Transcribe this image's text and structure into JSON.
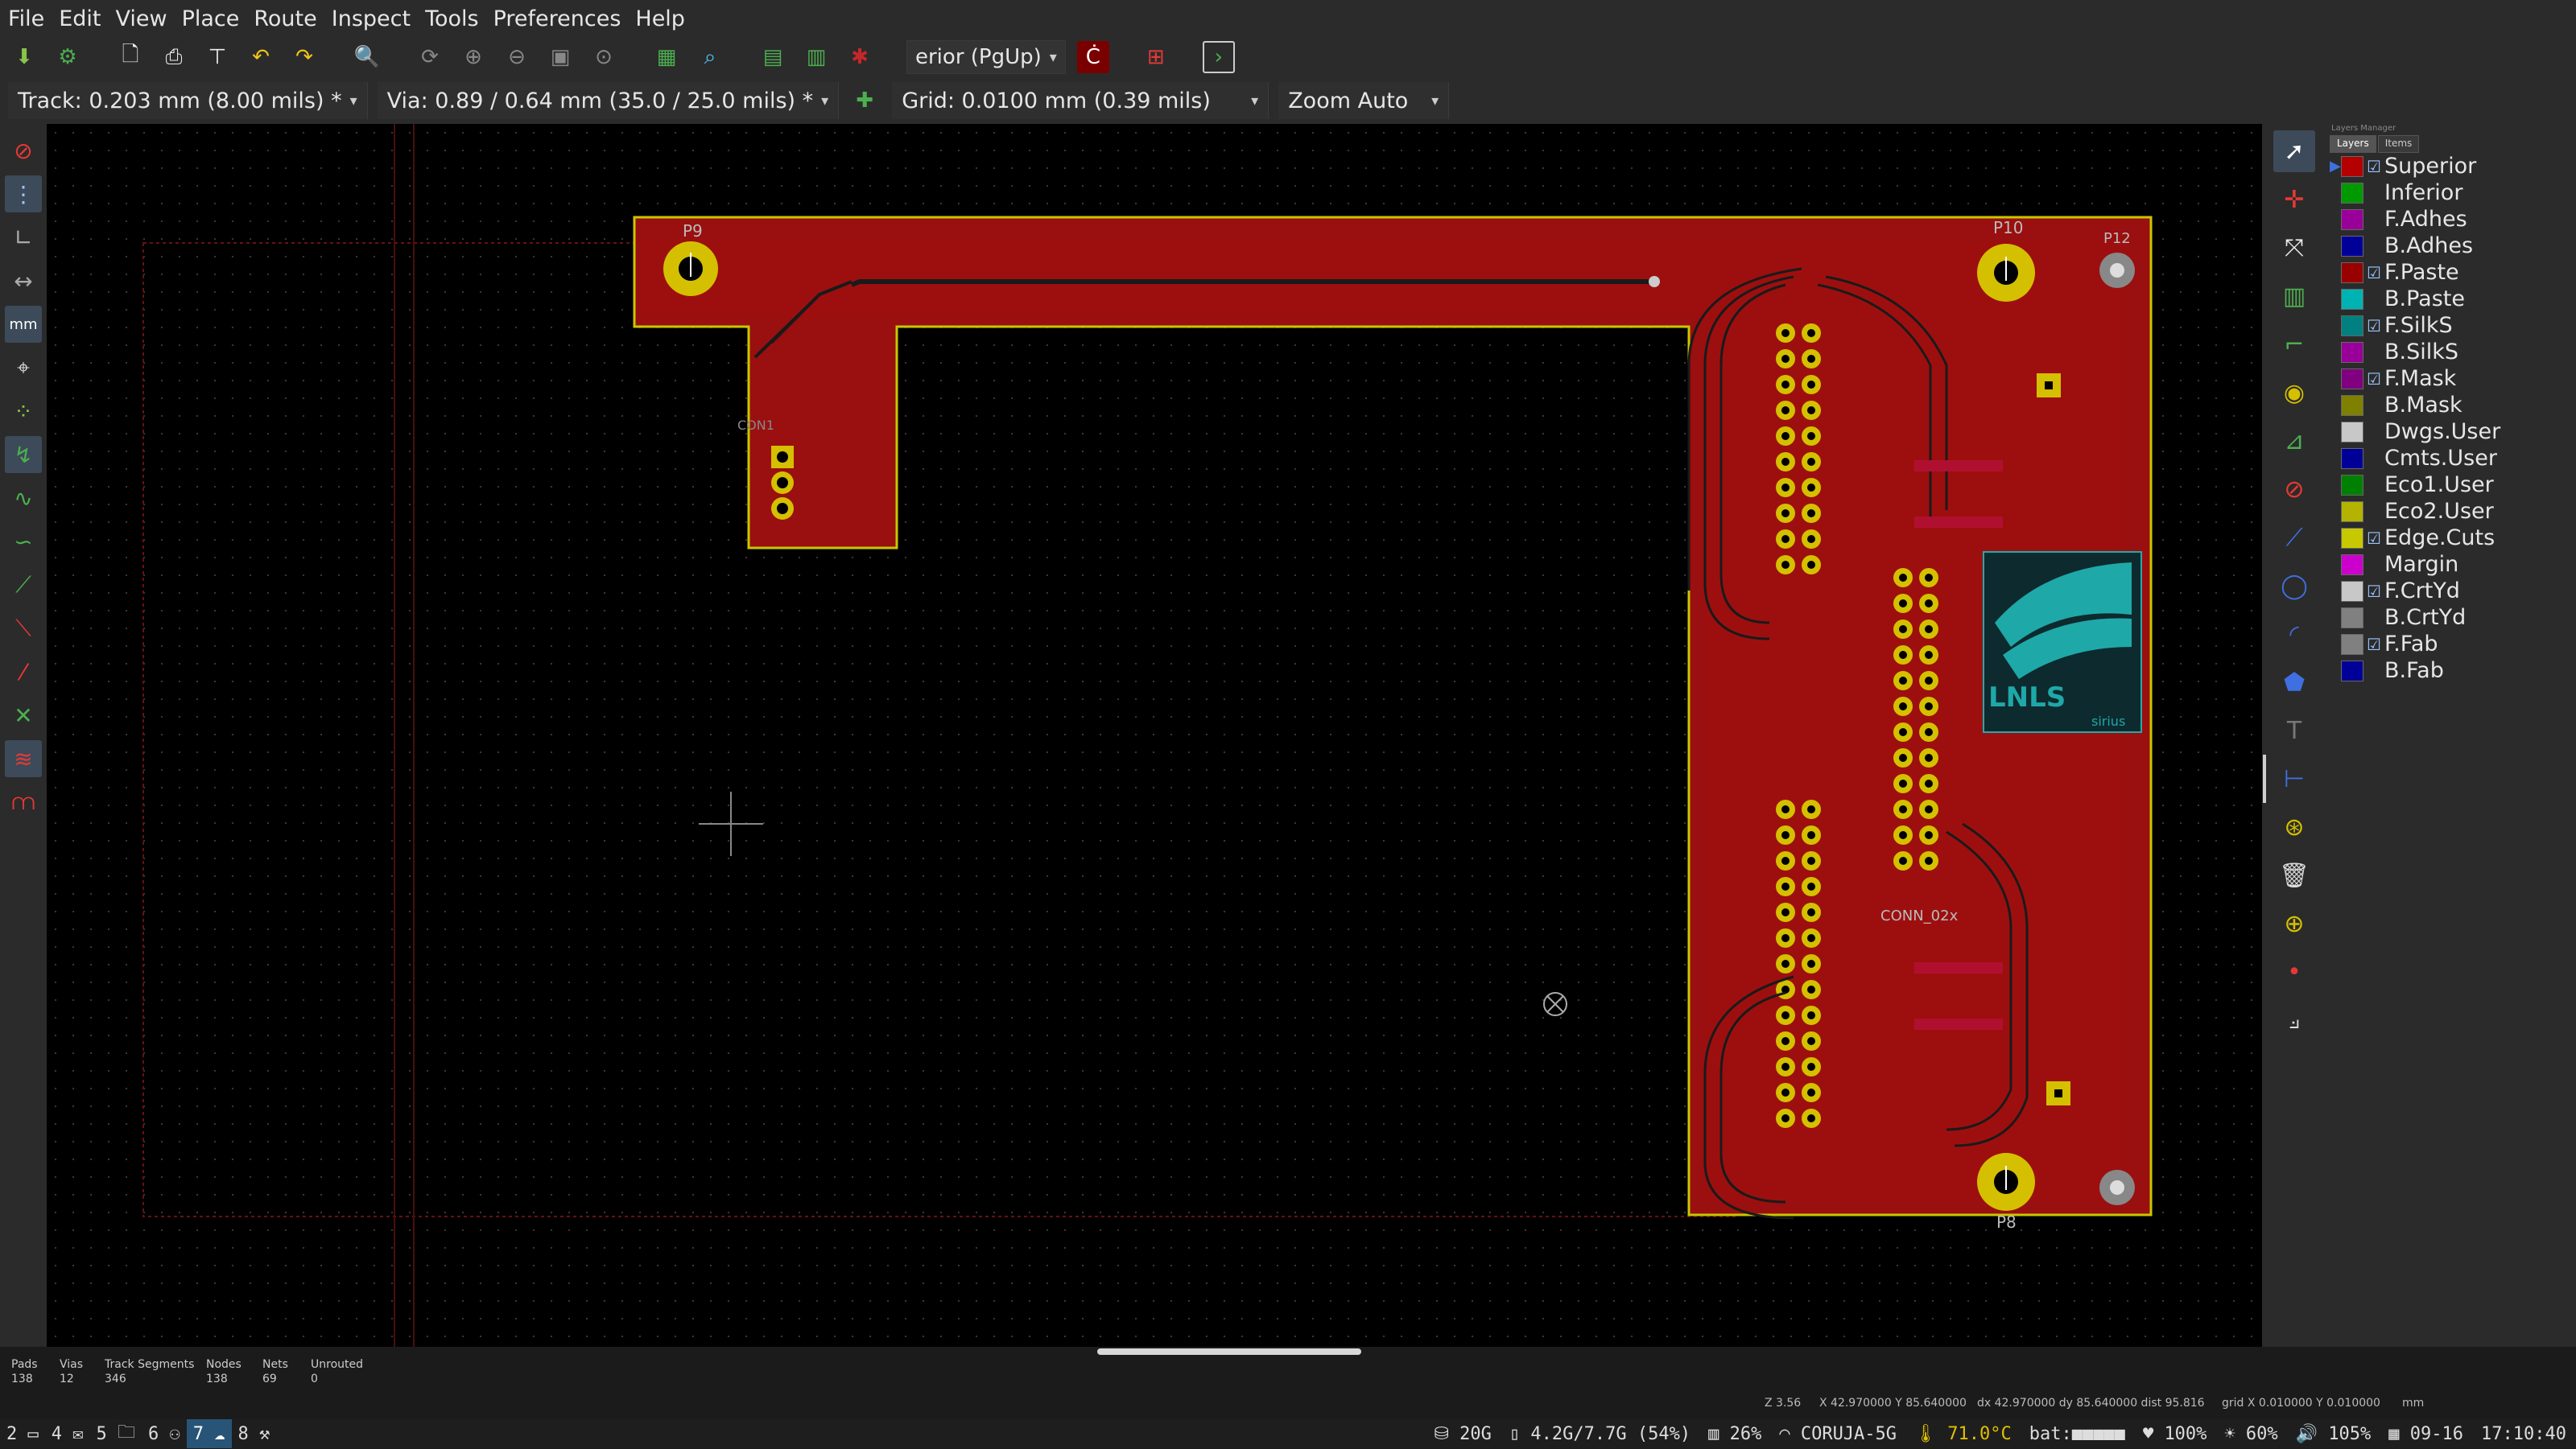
{
  "menu": [
    "File",
    "Edit",
    "View",
    "Place",
    "Route",
    "Inspect",
    "Tools",
    "Preferences",
    "Help"
  ],
  "toolbar": {
    "layer_select": "erior (PgUp)",
    "icons": [
      "board-setup-icon",
      "page-settings-icon",
      "new-board-icon",
      "print-icon",
      "plot-icon",
      "undo-icon",
      "redo-icon",
      "find-icon",
      "redraw-icon",
      "zoom-in-icon",
      "zoom-out-icon",
      "zoom-fit-icon",
      "zoom-selection-icon",
      "netlist-icon",
      "footprint-editor-icon",
      "footprint-viewer-icon",
      "bug-icon",
      "layer-pair-icon",
      "drc-icon",
      "scripting-icon"
    ]
  },
  "toolbar2": {
    "track": "Track: 0.203 mm (8.00 mils) *",
    "via": "Via: 0.89 / 0.64 mm (35.0 / 25.0 mils) *",
    "grid": "Grid: 0.0100 mm (0.39 mils)",
    "zoom": "Zoom Auto"
  },
  "layers_manager": {
    "title": "Layers Manager",
    "tabs": [
      "Layers",
      "Items"
    ],
    "layers": [
      {
        "name": "Superior",
        "color": "#b50000",
        "checked": true,
        "active": true
      },
      {
        "name": "Inferior",
        "color": "#009900",
        "checked": false
      },
      {
        "name": "F.Adhes",
        "color": "#990099",
        "checked": false
      },
      {
        "name": "B.Adhes",
        "color": "#000099",
        "checked": false
      },
      {
        "name": "F.Paste",
        "color": "#990000",
        "checked": true
      },
      {
        "name": "B.Paste",
        "color": "#00b3b3",
        "checked": false
      },
      {
        "name": "F.SilkS",
        "color": "#008080",
        "checked": true
      },
      {
        "name": "B.SilkS",
        "color": "#990099",
        "checked": false
      },
      {
        "name": "F.Mask",
        "color": "#800080",
        "checked": true
      },
      {
        "name": "B.Mask",
        "color": "#808000",
        "checked": false
      },
      {
        "name": "Dwgs.User",
        "color": "#c8c8c8",
        "checked": false
      },
      {
        "name": "Cmts.User",
        "color": "#000099",
        "checked": false
      },
      {
        "name": "Eco1.User",
        "color": "#008000",
        "checked": false
      },
      {
        "name": "Eco2.User",
        "color": "#b3b300",
        "checked": false
      },
      {
        "name": "Edge.Cuts",
        "color": "#c8c800",
        "checked": true
      },
      {
        "name": "Margin",
        "color": "#cc00cc",
        "checked": false
      },
      {
        "name": "F.CrtYd",
        "color": "#c8c8c8",
        "checked": true
      },
      {
        "name": "B.CrtYd",
        "color": "#808080",
        "checked": false
      },
      {
        "name": "F.Fab",
        "color": "#808080",
        "checked": true
      },
      {
        "name": "B.Fab",
        "color": "#000099",
        "checked": false
      }
    ]
  },
  "pcb": {
    "labels": [
      "P9",
      "P10",
      "P12",
      "P8",
      "CONN_02x",
      "LNLS",
      "sirius",
      "CON1"
    ]
  },
  "status": {
    "pads_label": "Pads",
    "pads": "138",
    "vias_label": "Vias",
    "vias": "12",
    "tracks_label": "Track Segments",
    "tracks": "346",
    "nodes_label": "Nodes",
    "nodes": "138",
    "nets_label": "Nets",
    "nets": "69",
    "unrouted_label": "Unrouted",
    "unrouted": "0",
    "zoom": "Z 3.56",
    "xy": "X 42.970000  Y 85.640000",
    "dxy": "dx 42.970000  dy 85.640000  dist 95.816",
    "grid": "grid X 0.010000  Y 0.010000",
    "units": "mm"
  },
  "taskbar": {
    "workspaces": [
      "2",
      "4",
      "5",
      "6",
      "7",
      "8"
    ],
    "active_ws": "7",
    "disk": "20G",
    "mem": "4.2G/7.7G (54%)",
    "cpu": "26%",
    "wifi": "CORUJA-5G",
    "temp": "71.0°C",
    "battery": "bat:■■■■■",
    "brightness": "100%",
    "bright2": "60%",
    "volume": "105%",
    "date": "09-16",
    "time": "17:10:40"
  }
}
